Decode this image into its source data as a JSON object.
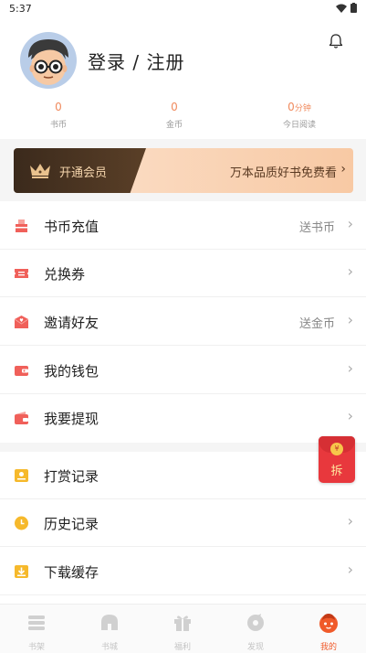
{
  "status_bar": {
    "time": "5:37"
  },
  "profile": {
    "login_text": "登录 / 注册"
  },
  "stats": [
    {
      "value": "0",
      "unit": "",
      "label": "书币"
    },
    {
      "value": "0",
      "unit": "",
      "label": "金币"
    },
    {
      "value": "0",
      "unit": "分钟",
      "label": "今日阅读"
    }
  ],
  "vip": {
    "label": "开通会员",
    "promo": "万本品质好书免费看",
    "chevron": "›"
  },
  "menu": [
    {
      "label": "书币充值",
      "extra": "送书币",
      "icon": "coin-box-icon"
    },
    {
      "label": "兑换券",
      "extra": "",
      "icon": "ticket-icon"
    },
    {
      "label": "邀请好友",
      "extra": "送金币",
      "icon": "heart-envelope-icon"
    },
    {
      "label": "我的钱包",
      "extra": "",
      "icon": "wallet-icon"
    },
    {
      "label": "我要提现",
      "extra": "",
      "icon": "withdraw-wallet-icon"
    },
    {
      "label": "打赏记录",
      "extra": "",
      "icon": "reward-icon"
    },
    {
      "label": "历史记录",
      "extra": "",
      "icon": "clock-icon"
    },
    {
      "label": "下载缓存",
      "extra": "",
      "icon": "download-icon"
    }
  ],
  "chevron": "›",
  "red_packet": {
    "coin": "¥",
    "text": "拆"
  },
  "bottom_nav": [
    {
      "label": "书架",
      "icon": "bookshelf-icon"
    },
    {
      "label": "书城",
      "icon": "bookstore-icon"
    },
    {
      "label": "福利",
      "icon": "gift-icon"
    },
    {
      "label": "发现",
      "icon": "discover-icon"
    },
    {
      "label": "我的",
      "icon": "profile-icon",
      "active": true
    }
  ],
  "colors": {
    "accent": "#f05a2a",
    "stat_number": "#f08a5d",
    "icon_red": "#f0605a",
    "icon_yellow": "#f6b92c"
  }
}
